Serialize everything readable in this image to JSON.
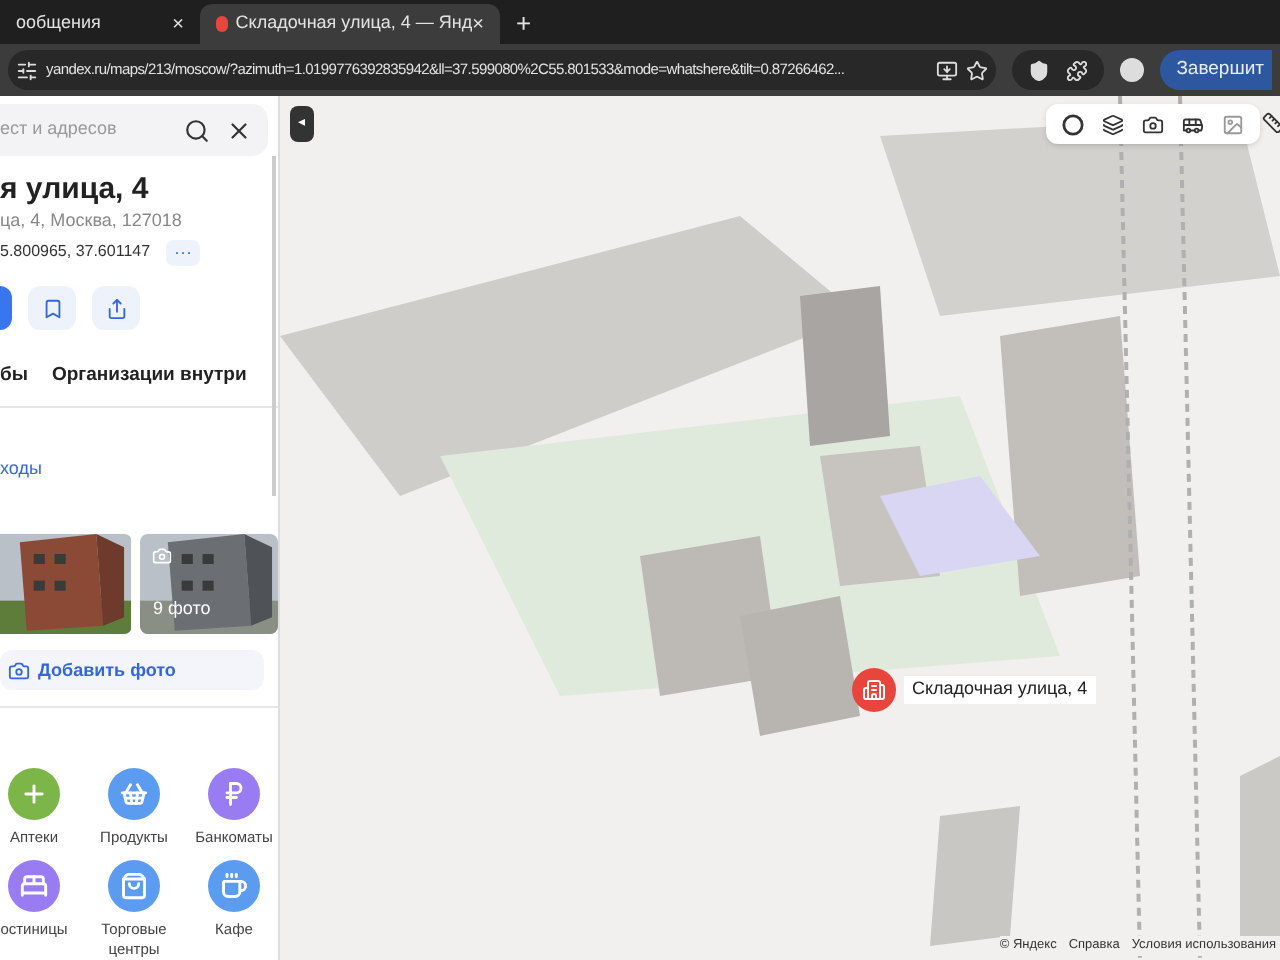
{
  "browser": {
    "tabs": [
      {
        "title": "ообщения",
        "selected": false,
        "close": "×"
      },
      {
        "title": "Складочная улица, 4 — Янд",
        "selected": true,
        "close": "×"
      }
    ],
    "new_tab": "+",
    "url": "yandex.ru/maps/213/moscow/?azimuth=1.0199776392835942&ll=37.599080%2C55.801533&mode=whatshere&tilt=0.87266462...",
    "finish_button": "Завершит"
  },
  "sidebar": {
    "search": {
      "placeholder": "ест и адресов"
    },
    "title": "я улица, 4",
    "address": "ца, 4, Москва, 127018",
    "coords": "5.800965, 37.601147",
    "more": "···",
    "tabs": [
      {
        "label": "бы",
        "selected": false
      },
      {
        "label": "Организации внутри",
        "selected": false
      }
    ],
    "link": "ходы",
    "photos": [
      {
        "kind": "picture"
      },
      {
        "kind": "picture",
        "count": "9 фото"
      }
    ],
    "add_photo": "Добавить фото",
    "categories": [
      {
        "label": "Аптеки",
        "color": "#7cb548",
        "kind": "plus"
      },
      {
        "label": "Продукты",
        "color": "#5b9cf0",
        "kind": "basket"
      },
      {
        "label": "Банкоматы",
        "color": "#9a7cf2",
        "kind": "ruble"
      },
      {
        "label": "остиницы",
        "color": "#9a7cf2",
        "kind": "bed"
      },
      {
        "label": "Торговые центры",
        "color": "#5b9cf0",
        "kind": "bag"
      },
      {
        "label": "Кафе",
        "color": "#5b9cf0",
        "kind": "cup"
      }
    ]
  },
  "map": {
    "collapse": "◂",
    "pin_label": "Складочная улица, 4",
    "attribution": [
      "© Яндекс",
      "Справка",
      "Условия использования"
    ]
  }
}
